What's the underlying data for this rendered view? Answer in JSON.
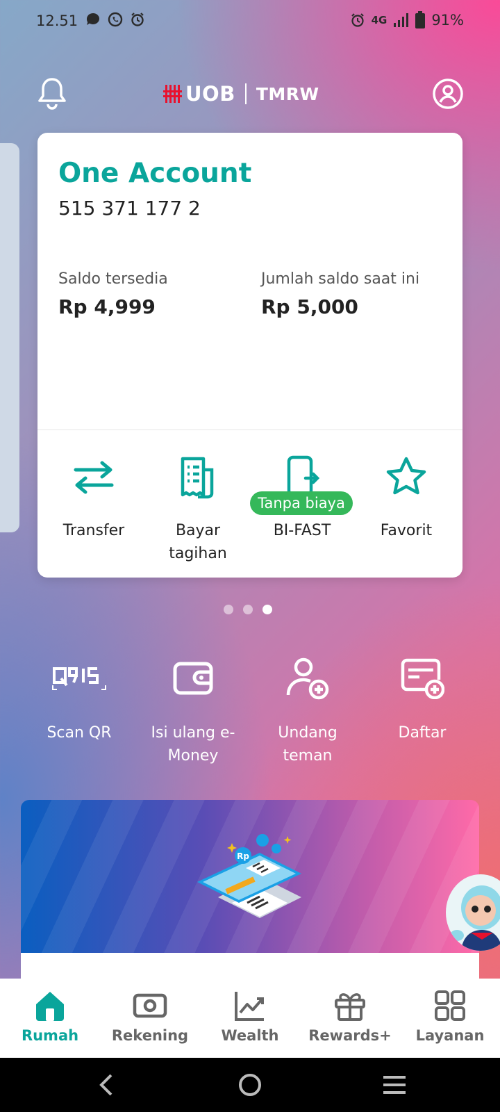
{
  "status_bar": {
    "time": "12.51",
    "network": "4G",
    "battery": "91%"
  },
  "header": {
    "logo_left": "UOB",
    "logo_right": "TMRW"
  },
  "account": {
    "name": "One Account",
    "number": "515 371 177 2",
    "available_label": "Saldo tersedia",
    "available_value": "Rp 4,999",
    "current_label": "Jumlah saldo saat ini",
    "current_value": "Rp 5,000"
  },
  "card_actions": [
    {
      "label": "Transfer",
      "icon": "transfer-arrows-icon"
    },
    {
      "label": "Bayar tagihan",
      "icon": "bill-receipt-icon"
    },
    {
      "label": "BI-FAST",
      "icon": "phone-transfer-icon",
      "badge": "Tanpa biaya"
    },
    {
      "label": "Favorit",
      "icon": "star-icon"
    }
  ],
  "carousel": {
    "pages": 3,
    "active": 3
  },
  "quick_actions": [
    {
      "label": "Scan QR",
      "icon": "qris-icon"
    },
    {
      "label": "Isi ulang e-Money",
      "icon": "wallet-icon"
    },
    {
      "label": "Undang teman",
      "icon": "add-user-icon"
    },
    {
      "label": "Daftar",
      "icon": "register-form-icon"
    }
  ],
  "banner": {
    "qr_badge_text": "Rp"
  },
  "bottom_nav": [
    {
      "label": "Rumah",
      "icon": "home-icon",
      "active": true
    },
    {
      "label": "Rekening",
      "icon": "account-cash-icon",
      "active": false
    },
    {
      "label": "Wealth",
      "icon": "chart-line-icon",
      "active": false
    },
    {
      "label": "Rewards+",
      "icon": "gift-icon",
      "active": false
    },
    {
      "label": "Layanan",
      "icon": "grid-icon",
      "active": false
    }
  ],
  "colors": {
    "accent": "#0aa59b",
    "brand_red": "#e8112d",
    "badge_green": "#35b85a"
  }
}
